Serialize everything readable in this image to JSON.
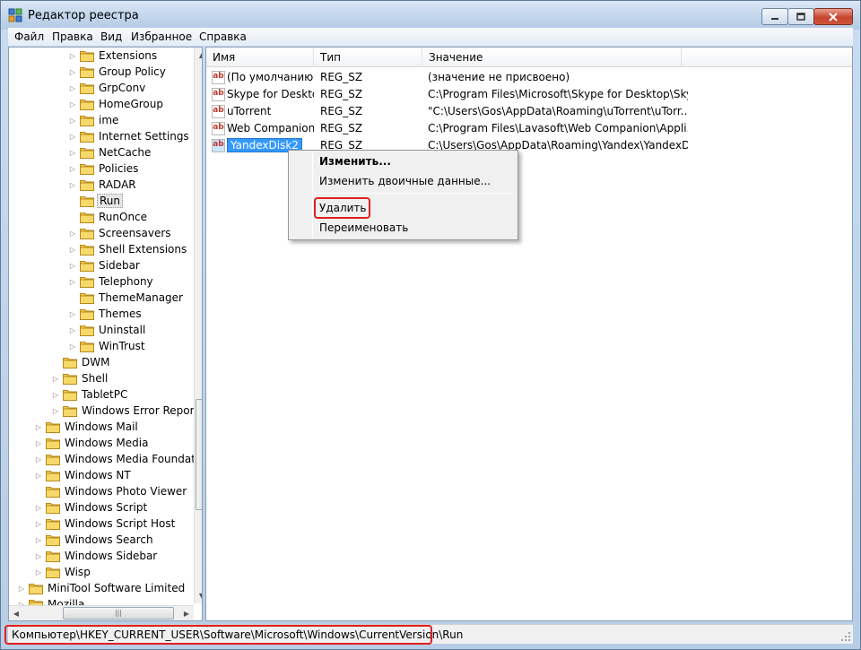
{
  "window": {
    "title": "Редактор реестра"
  },
  "menu": [
    "Файл",
    "Правка",
    "Вид",
    "Избранное",
    "Справка"
  ],
  "tree": {
    "items": [
      {
        "label": "Extensions",
        "level": 3,
        "expandable": true
      },
      {
        "label": "Group Policy",
        "level": 3,
        "expandable": true
      },
      {
        "label": "GrpConv",
        "level": 3,
        "expandable": true
      },
      {
        "label": "HomeGroup",
        "level": 3,
        "expandable": true
      },
      {
        "label": "ime",
        "level": 3,
        "expandable": true
      },
      {
        "label": "Internet Settings",
        "level": 3,
        "expandable": true
      },
      {
        "label": "NetCache",
        "level": 3,
        "expandable": true
      },
      {
        "label": "Policies",
        "level": 3,
        "expandable": true
      },
      {
        "label": "RADAR",
        "level": 3,
        "expandable": true
      },
      {
        "label": "Run",
        "level": 3,
        "expandable": false,
        "selected": true
      },
      {
        "label": "RunOnce",
        "level": 3,
        "expandable": false
      },
      {
        "label": "Screensavers",
        "level": 3,
        "expandable": true
      },
      {
        "label": "Shell Extensions",
        "level": 3,
        "expandable": true
      },
      {
        "label": "Sidebar",
        "level": 3,
        "expandable": true
      },
      {
        "label": "Telephony",
        "level": 3,
        "expandable": true
      },
      {
        "label": "ThemeManager",
        "level": 3,
        "expandable": false
      },
      {
        "label": "Themes",
        "level": 3,
        "expandable": true
      },
      {
        "label": "Uninstall",
        "level": 3,
        "expandable": true
      },
      {
        "label": "WinTrust",
        "level": 3,
        "expandable": true
      },
      {
        "label": "DWM",
        "level": 2,
        "expandable": false
      },
      {
        "label": "Shell",
        "level": 2,
        "expandable": true
      },
      {
        "label": "TabletPC",
        "level": 2,
        "expandable": true
      },
      {
        "label": "Windows Error Reporting",
        "level": 2,
        "expandable": true
      },
      {
        "label": "Windows Mail",
        "level": 1,
        "expandable": true
      },
      {
        "label": "Windows Media",
        "level": 1,
        "expandable": true
      },
      {
        "label": "Windows Media Foundation",
        "level": 1,
        "expandable": true
      },
      {
        "label": "Windows NT",
        "level": 1,
        "expandable": true
      },
      {
        "label": "Windows Photo Viewer",
        "level": 1,
        "expandable": false
      },
      {
        "label": "Windows Script",
        "level": 1,
        "expandable": true
      },
      {
        "label": "Windows Script Host",
        "level": 1,
        "expandable": true
      },
      {
        "label": "Windows Search",
        "level": 1,
        "expandable": true
      },
      {
        "label": "Windows Sidebar",
        "level": 1,
        "expandable": true
      },
      {
        "label": "Wisp",
        "level": 1,
        "expandable": true
      },
      {
        "label": "MiniTool Software Limited",
        "level": 0,
        "expandable": true
      },
      {
        "label": "Mozilla",
        "level": 0,
        "expandable": true
      }
    ]
  },
  "list": {
    "columns": [
      "Имя",
      "Тип",
      "Значение"
    ],
    "rows": [
      {
        "name": "(По умолчанию)",
        "type": "REG_SZ",
        "value": "(значение не присвоено)"
      },
      {
        "name": "Skype for Desktop",
        "type": "REG_SZ",
        "value": "C:\\Program Files\\Microsoft\\Skype for Desktop\\Sky..."
      },
      {
        "name": "uTorrent",
        "type": "REG_SZ",
        "value": "\"C:\\Users\\Gos\\AppData\\Roaming\\uTorrent\\uTorr..."
      },
      {
        "name": "Web Companion",
        "type": "REG_SZ",
        "value": "C:\\Program Files\\Lavasoft\\Web Companion\\Appli..."
      },
      {
        "name": "YandexDisk2",
        "type": "REG_SZ",
        "value": "C:\\Users\\Gos\\AppData\\Roaming\\Yandex\\YandexD...",
        "selected": true
      }
    ],
    "icon_text": "ab"
  },
  "context_menu": {
    "items": [
      "Изменить...",
      "Изменить двоичные данные...",
      "Удалить",
      "Переименовать"
    ],
    "default_item": "Изменить...",
    "highlighted_item": "Удалить"
  },
  "statusbar": {
    "path": "Компьютер\\HKEY_CURRENT_USER\\Software\\Microsoft\\Windows\\CurrentVersion\\Run"
  },
  "colors": {
    "selection": "#3399ff",
    "highlight_box": "#e02020",
    "folder": "#f2c94c"
  }
}
